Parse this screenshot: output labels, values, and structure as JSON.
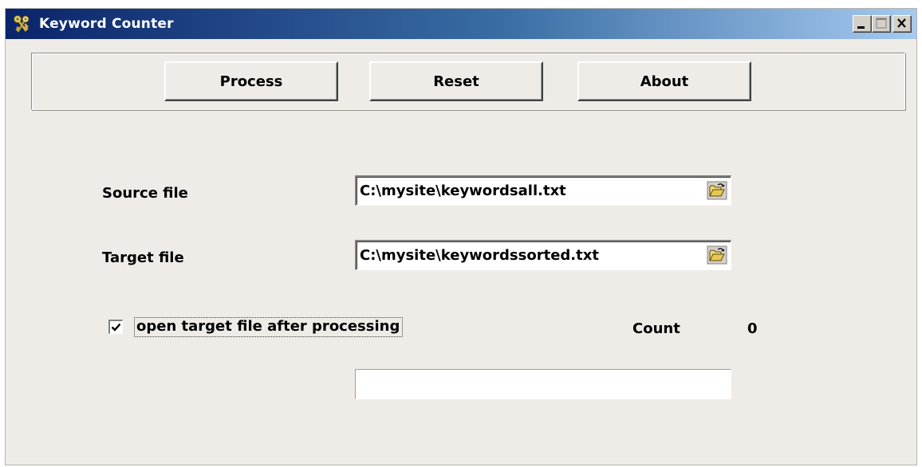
{
  "window": {
    "title": "Keyword Counter",
    "title_gradient": [
      "#0a246a",
      "#3a6ea5",
      "#a6caf0"
    ],
    "background": "#efebe7",
    "controls": [
      "minimize-icon",
      "maximize-icon",
      "close-icon"
    ]
  },
  "toolbar": {
    "process_label": "Process",
    "reset_label": "Reset",
    "about_label": "About"
  },
  "form": {
    "source_label": "Source file",
    "source_value": "C:\\mysite\\keywordsall.txt",
    "target_label": "Target file",
    "target_value": "C:\\mysite\\keywordssorted.txt",
    "browse_icon": "folder-open-icon",
    "open_after_label": "open target file after processing",
    "open_after_checked": true,
    "count_label": "Count",
    "count_value": "0",
    "progress": 0
  }
}
